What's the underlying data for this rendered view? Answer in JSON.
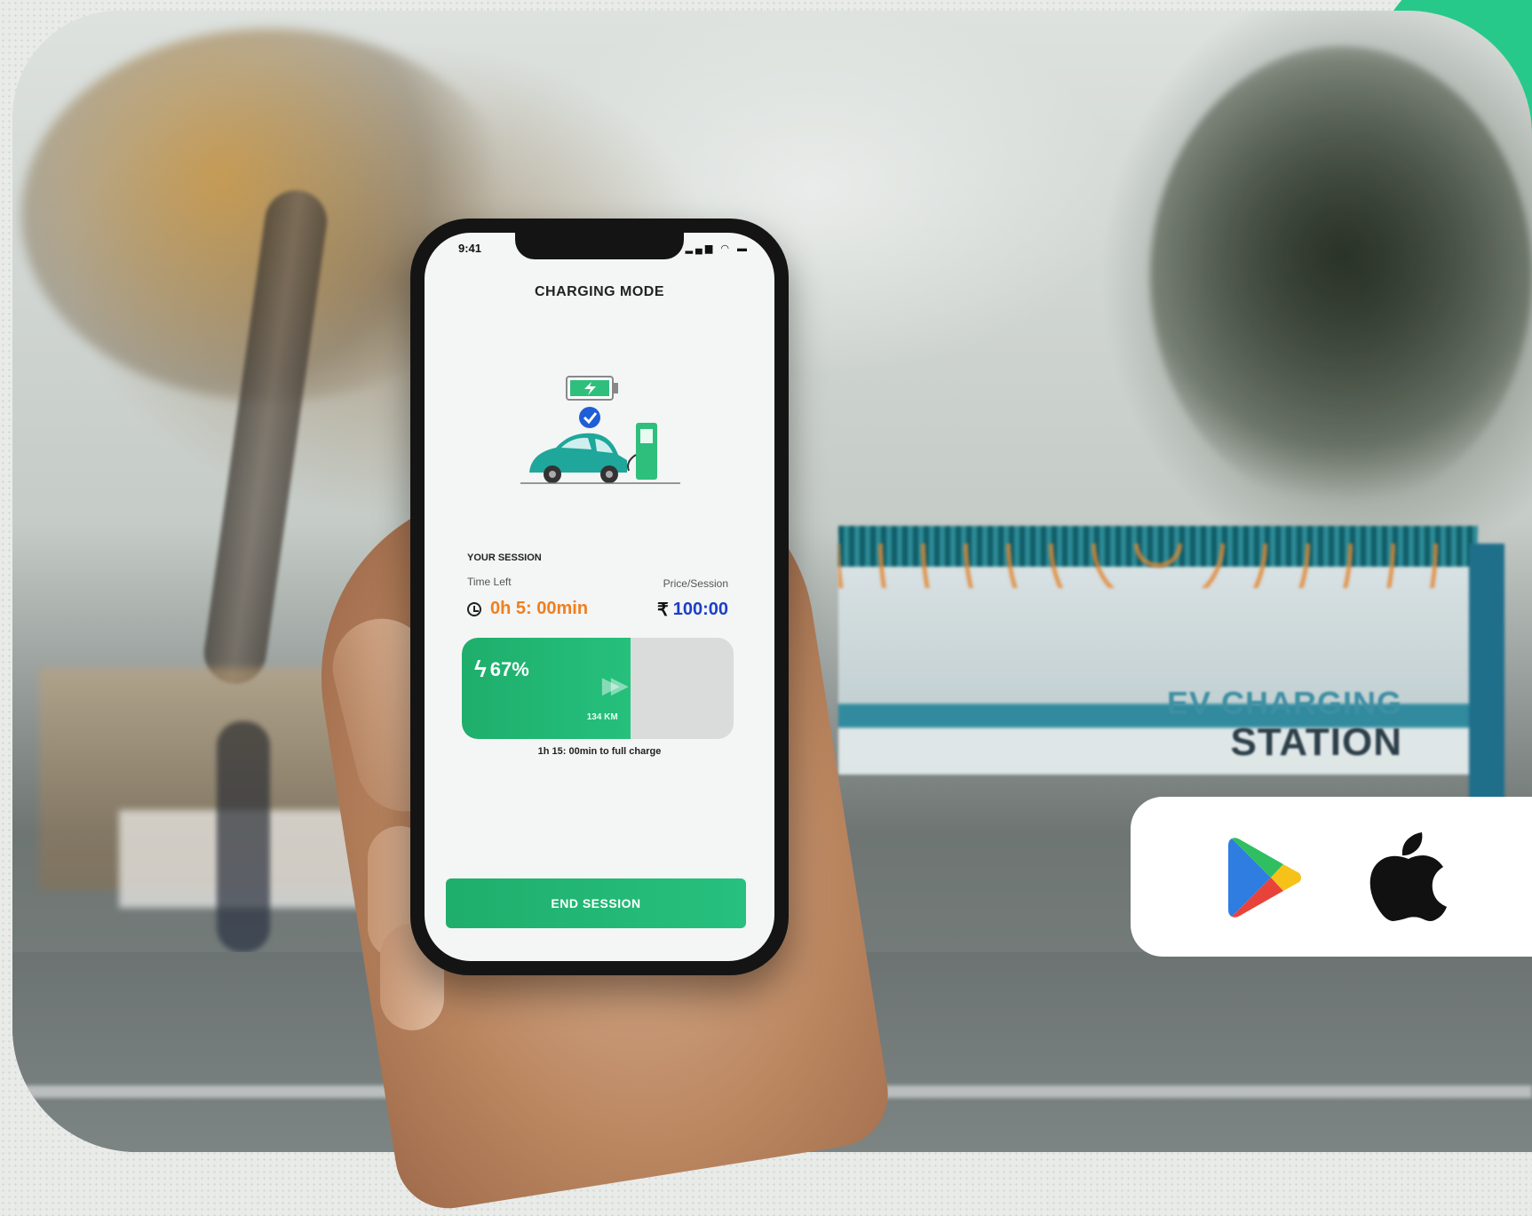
{
  "phone": {
    "status_time": "9:41",
    "title": "CHARGING MODE",
    "session_label": "YOUR SESSION",
    "time_left_label": "Time Left",
    "time_left_value": "0h 5: 00min",
    "price_label": "Price/Session",
    "price_currency": "₹",
    "price_value": "100:00",
    "battery_percent": "67%",
    "battery_level": 0.62,
    "range_text": "134 KM",
    "full_charge_text": "1h 15: 00min to full charge",
    "end_button_label": "END SESSION"
  },
  "background_sign": {
    "line1": "EV CHARGING",
    "line2": "STATION"
  },
  "stores": {
    "play_icon": "google-play-icon",
    "apple_icon": "apple-app-store-icon"
  },
  "colors": {
    "accent_green": "#1fae6c",
    "time_orange": "#f07f1e",
    "price_blue": "#1c3fc7"
  }
}
